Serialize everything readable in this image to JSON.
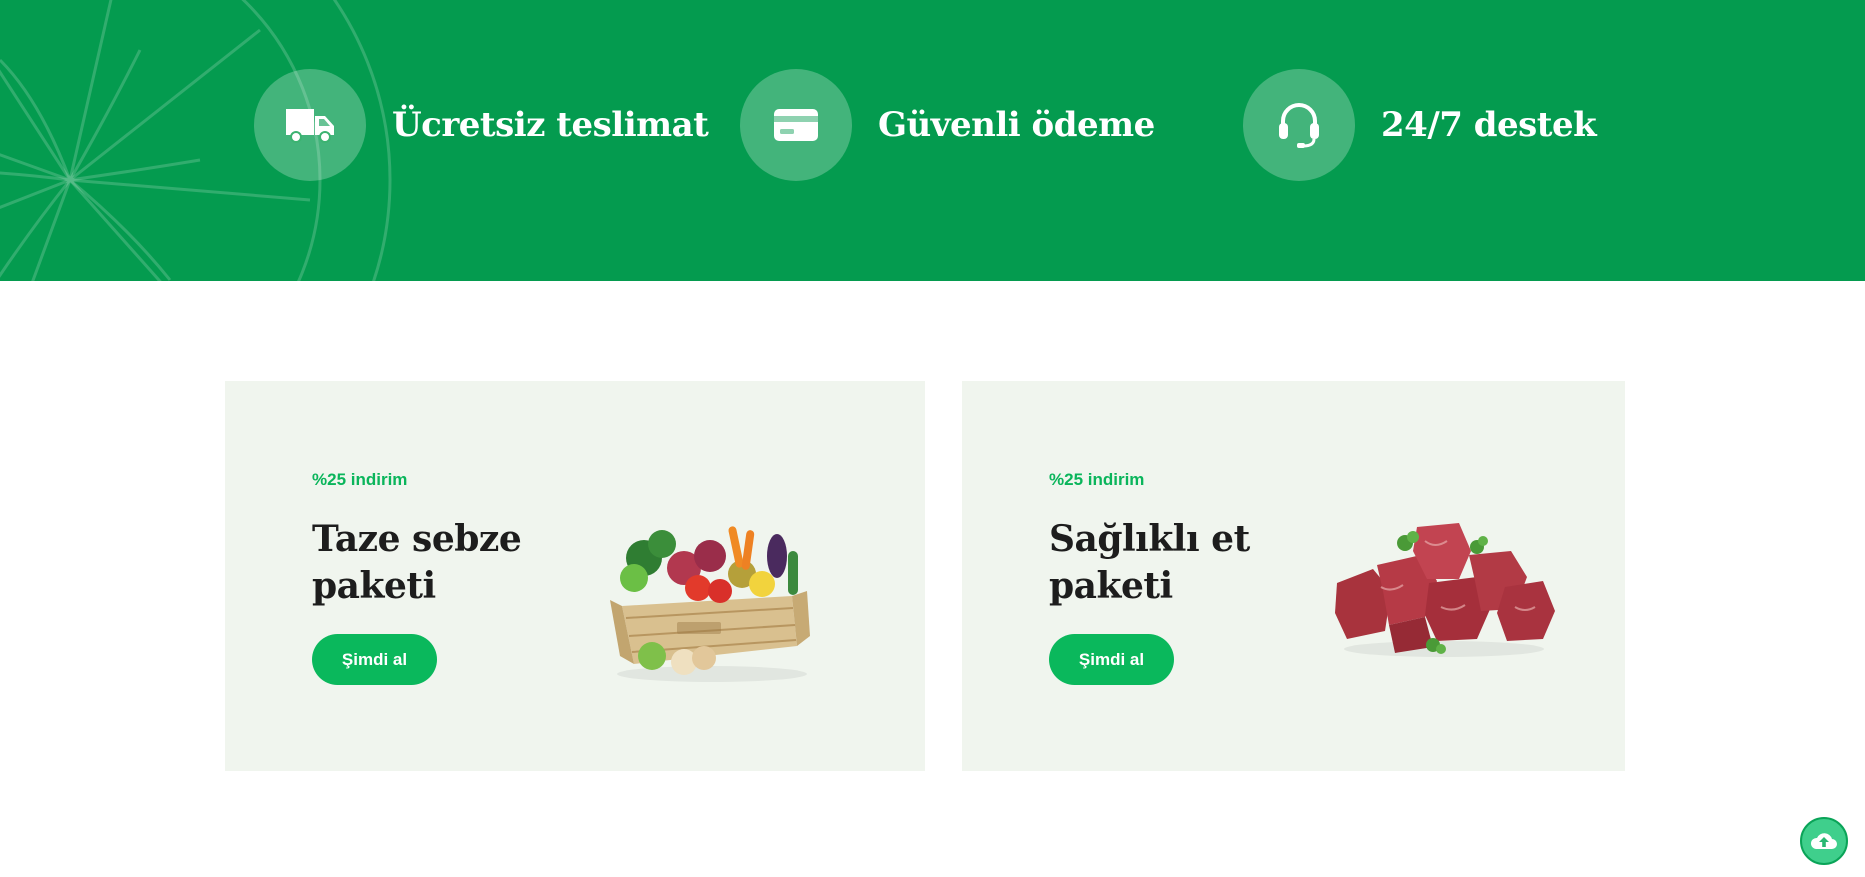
{
  "features": [
    {
      "icon": "truck-icon",
      "title": "Ücretsiz teslimat"
    },
    {
      "icon": "credit-card-icon",
      "title": "Güvenli ödeme"
    },
    {
      "icon": "headset-icon",
      "title": "24/7 destek"
    }
  ],
  "promos": [
    {
      "eyebrow": "%25 indirim",
      "title": "Taze sebze paketi",
      "button": "Şimdi al",
      "image": "vegetable-crate-image"
    },
    {
      "eyebrow": "%25 indirim",
      "title": "Sağlıklı et paketi",
      "button": "Şimdi al",
      "image": "meat-cubes-image"
    }
  ],
  "scroll_top": {
    "icon": "cloud-up-icon"
  },
  "colors": {
    "banner": "#049b4f",
    "accent": "#0ab85c",
    "card_bg": "#f0f5ee",
    "heading": "#1d1d1d"
  }
}
